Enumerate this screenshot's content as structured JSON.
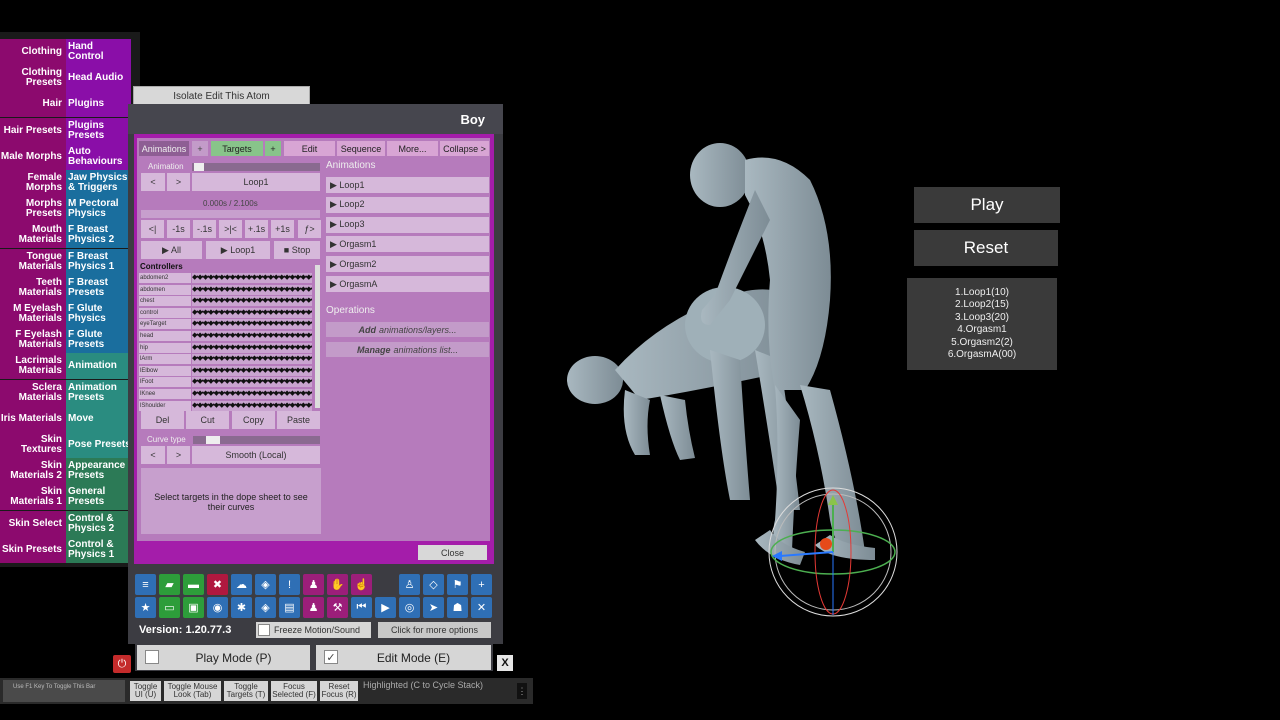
{
  "category_menu": [
    {
      "left": "Clothing",
      "right": "Hand Control",
      "right_color": "purple"
    },
    {
      "left": "Clothing Presets",
      "right": "Head Audio",
      "right_color": "purple"
    },
    {
      "left": "Hair",
      "right": "Plugins",
      "right_color": "purple"
    },
    {
      "left": "Hair Presets",
      "right": "Plugins Presets",
      "right_color": "purple"
    },
    {
      "left": "Male Morphs",
      "right": "Auto Behaviours",
      "right_color": "purple"
    },
    {
      "left": "Female Morphs",
      "right": "Jaw Physics & Triggers",
      "right_color": "blue"
    },
    {
      "left": "Morphs Presets",
      "right": "M Pectoral Physics",
      "right_color": "blue"
    },
    {
      "left": "Mouth Materials",
      "right": "F Breast Physics 2",
      "right_color": "blue"
    },
    {
      "left": "Tongue Materials",
      "right": "F Breast Physics 1",
      "right_color": "blue"
    },
    {
      "left": "Teeth Materials",
      "right": "F Breast Presets",
      "right_color": "blue"
    },
    {
      "left": "M Eyelash Materials",
      "right": "F Glute Physics",
      "right_color": "blue"
    },
    {
      "left": "F Eyelash Materials",
      "right": "F Glute Presets",
      "right_color": "blue"
    },
    {
      "left": "Lacrimals Materials",
      "right": "Animation",
      "right_color": "teal"
    },
    {
      "left": "Sclera Materials",
      "right": "Animation Presets",
      "right_color": "teal"
    },
    {
      "left": "Iris Materials",
      "right": "Move",
      "right_color": "teal"
    },
    {
      "left": "Skin Textures",
      "right": "Pose Presets",
      "right_color": "teal"
    },
    {
      "left": "Skin Materials 2",
      "right": "Appearance Presets",
      "right_color": "green"
    },
    {
      "left": "Skin Materials 1",
      "right": "General Presets",
      "right_color": "green"
    },
    {
      "left": "Skin Select",
      "right": "Control & Physics 2",
      "right_color": "green"
    },
    {
      "left": "Skin Presets",
      "right": "Control & Physics 1",
      "right_color": "green"
    }
  ],
  "isolate_label": "Isolate Edit This Atom",
  "atom_title": "Boy",
  "tabs": {
    "animations": "Animations",
    "plus1": "+",
    "targets": "Targets",
    "plus2": "+",
    "edit": "Edit",
    "sequence": "Sequence",
    "more": "More...",
    "collapse": "Collapse >"
  },
  "animation_label": "Animation",
  "prev": "<",
  "next": ">",
  "current_animation": "Loop1",
  "time_readout": "0.000s / 2.100s",
  "time_buttons": [
    "<|",
    "-1s",
    "-.1s",
    ">|<",
    "+.1s",
    "+1s",
    "ƒ>"
  ],
  "play_all": "▶ All",
  "play_loop1": "▶ Loop1",
  "stop": "■ Stop",
  "controllers_label": "Controllers",
  "controllers": [
    "abdomen2",
    "abdomen",
    "chest",
    "control",
    "eyeTarget",
    "head",
    "hip",
    "lArm",
    "lElbow",
    "lFoot",
    "lKnee",
    "lShoulder"
  ],
  "keyframe_dots": "◆•◆•◆•◆•◆•◆•◆•◆•◆•◆•◆•◆•◆•◆•◆•◆•◆•◆•◆•◆•◆•◆•◆•◆•",
  "edit_buttons": [
    "Del",
    "Cut",
    "Copy",
    "Paste"
  ],
  "curve_type_label": "Curve type",
  "curve_type": "Smooth (Local)",
  "help_text": "Select targets in the dope sheet to see their curves",
  "animations_header": "Animations",
  "animations_list": [
    "▶ Loop1",
    "▶ Loop2",
    "▶ Loop3",
    "▶ Orgasm1",
    "▶ Orgasm2",
    "▶ OrgasmA"
  ],
  "operations_header": "Operations",
  "op_add_bold": "Add",
  "op_add_rest": "animations/layers...",
  "op_manage_bold": "Manage",
  "op_manage_rest": "animations list...",
  "close_label": "Close",
  "toolbar_icons": [
    "menu-icon",
    "open-scene-icon",
    "folder-icon",
    "delete-icon",
    "cloud-download-icon",
    "package-icon",
    "alert-icon",
    "person-add-icon",
    "hand-icon",
    "hand-pointer-icon",
    "person-icon",
    "cube-icon",
    "flag-icon",
    "plus-icon",
    "star-icon",
    "folder-open-icon",
    "screenshot-icon",
    "camera-icon",
    "network-icon",
    "package-open-icon",
    "document-icon",
    "person-select-icon",
    "hammer-icon",
    "skip-back-icon",
    "play-icon",
    "target-icon",
    "cursor-icon",
    "people-icon",
    "tools-icon"
  ],
  "version": "Version: 1.20.77.3",
  "freeze_label": "Freeze Motion/Sound",
  "more_options": "Click for more options",
  "play_mode": "Play Mode (P)",
  "edit_mode": "Edit Mode (E)",
  "edit_checked": "✓",
  "power_icon": "⏻",
  "close_x": "X",
  "f1_hint": "Use F1 Key To Toggle This Bar",
  "bottom_buttons": [
    "Toggle UI (U)",
    "Toggle Mouse Look (Tab)",
    "Toggle Targets (T)",
    "Focus Selected (F)",
    "Reset Focus (R)"
  ],
  "highlighted": "Highlighted (C to Cycle Stack)",
  "grip": "⋮",
  "scene_play": "Play",
  "scene_reset": "Reset",
  "loop_list": [
    "1.Loop1(10)",
    "2.Loop2(15)",
    "3.Loop3(20)",
    "4.Orgasm1",
    "5.Orgasm2(2)",
    "6.OrgasmA(00)"
  ],
  "colors": {
    "menu_magenta": "#8c0a6e",
    "menu_purple": "#8a0ea8",
    "menu_blue": "#1a6e9e",
    "menu_teal": "#2a8c80",
    "menu_green": "#2c7a56",
    "plugin_bg": "#b67bbc"
  }
}
